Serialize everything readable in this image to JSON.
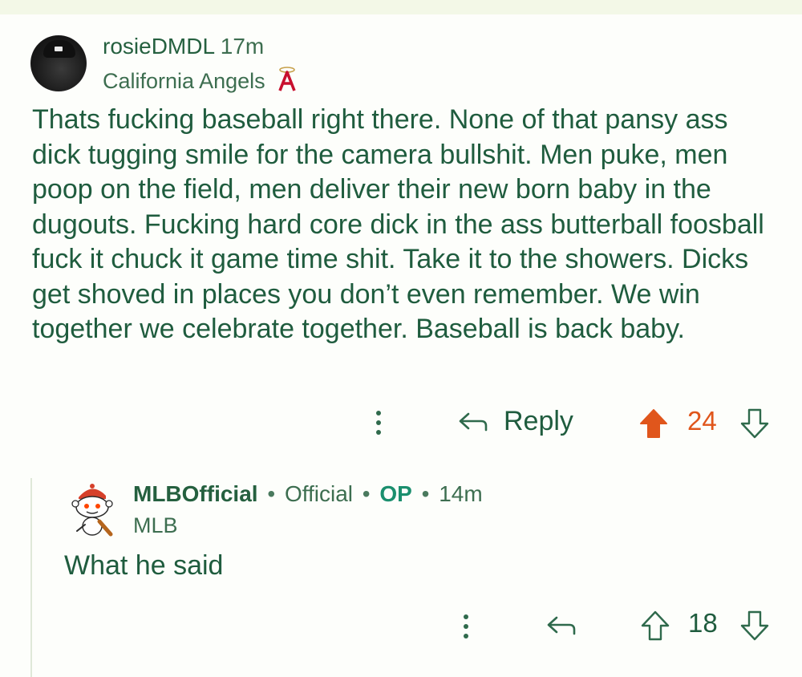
{
  "comment1": {
    "username": "rosieDMDL",
    "time": "17m",
    "flair": "California Angels",
    "flair_logo_icon": "angels-logo-icon",
    "body": "Thats fucking baseball right there. None of that pansy ass dick tugging smile for the camera bullshit. Men puke, men poop on the field, men deliver their new born baby in the dugouts. Fucking hard core dick in the ass butterball foosball fuck it chuck it game time shit. Take it to the showers. Dicks get shoved in places you don’t even remember. We win together we celebrate together. Baseball is back baby.",
    "reply_label": "Reply",
    "score": "24",
    "upvoted": true
  },
  "comment2": {
    "username": "MLBOfficial",
    "official": "Official",
    "op": "OP",
    "time": "14m",
    "separator": "•",
    "flair": "MLB",
    "body": "What he said",
    "score": "18",
    "upvoted": false
  },
  "colors": {
    "text": "#1f5c3e",
    "upvote": "#e0561c",
    "op": "#1b8f6e",
    "background": "#fdfefb"
  }
}
